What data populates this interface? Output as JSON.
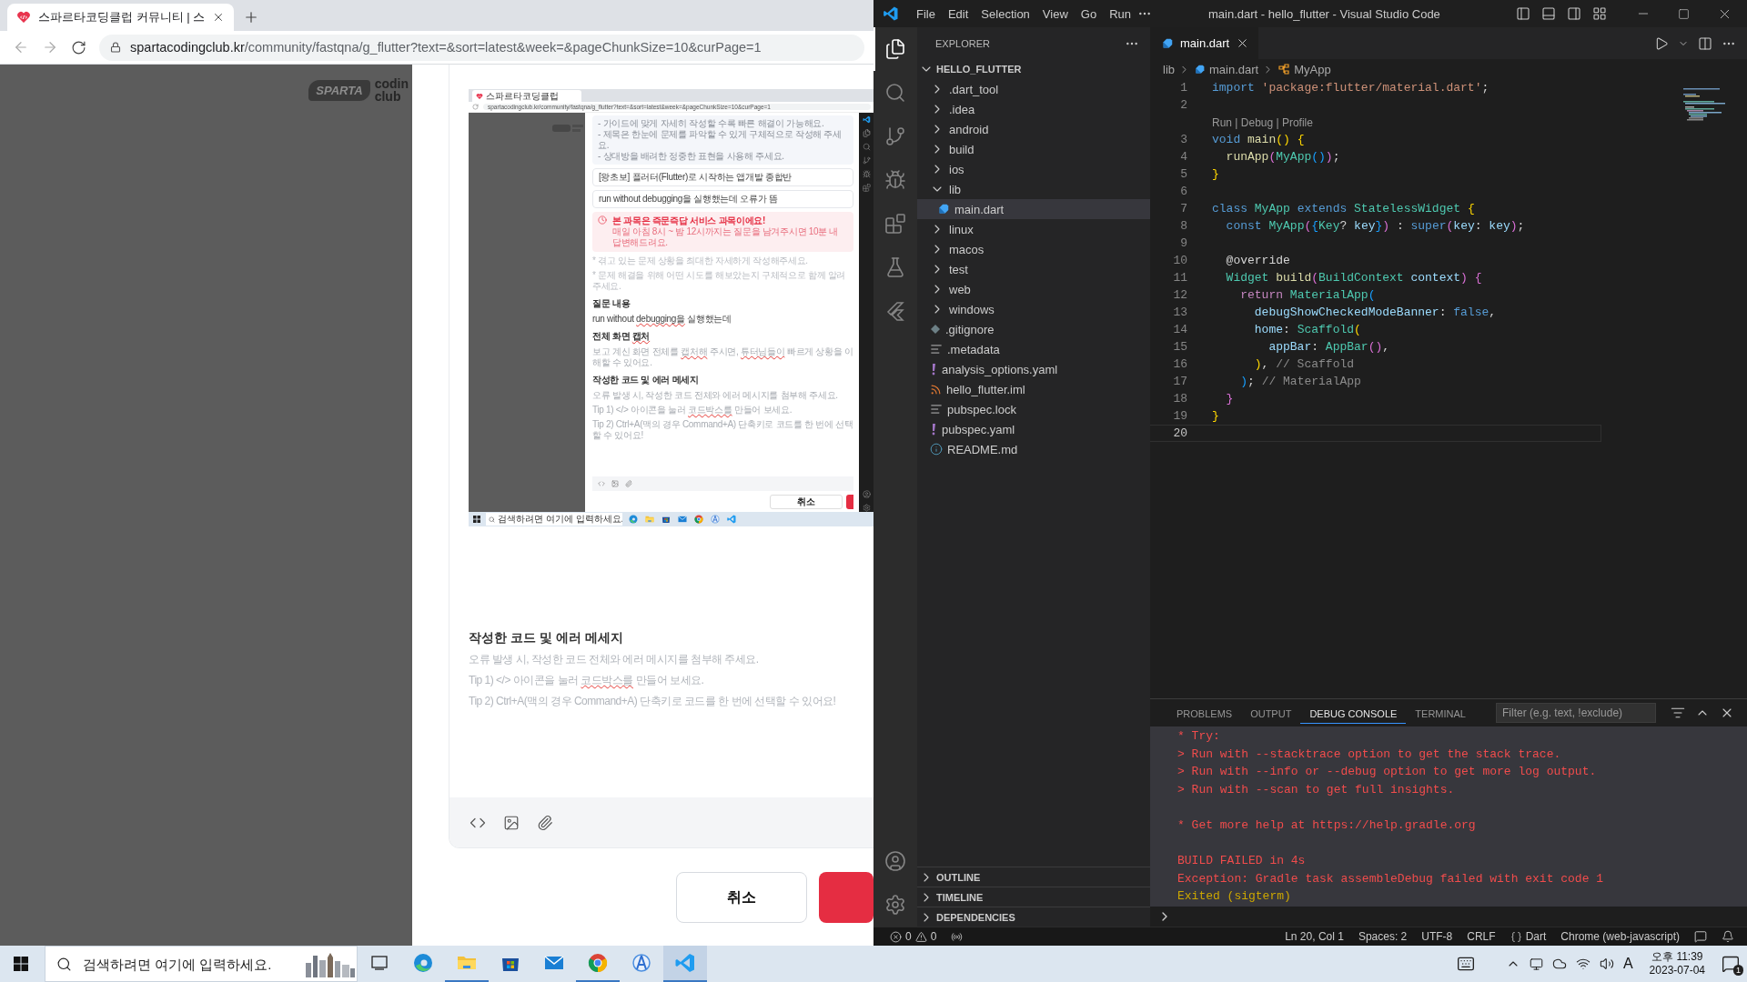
{
  "browser": {
    "tab": {
      "title": "스파르타코딩클럽 커뮤니티 | 스",
      "selected": true
    },
    "address": {
      "host": "spartacodingclub.kr",
      "path": "/community/fastqna/g_flutter?text=&sort=latest&week=&pageChunkSize=10&curPage=1"
    },
    "logo": {
      "mark": "SPARTA",
      "word_1": "codin",
      "word_2": "club"
    },
    "embedded_screenshot": {
      "tab_title": "스파르타코딩클럽",
      "url": "spartacodingclub.kr/community/fastqna/g_flutter?text=&sort=latest&week=&pageChunkSize=10&curPage=1",
      "guide": [
        "- 가이드에 맞게 자세히 작성할 수록 빠른 해결이 가능해요.",
        "- 제목은 한눈에 문제를 파악할 수 있게 구체적으로 작성해 주세요.",
        "- 상대방을 배려한 정중한 표현을 사용해 주세요."
      ],
      "course": "[왕초보] 플러터(Flutter)로 시작하는 앱개발 종합반",
      "title": "run without debugging을 실행했는데 오류가 뜸",
      "notice": {
        "title": "본 과목은 즉문즉답 서비스 과목이에요!",
        "text": "매일 아침 8시 ~ 밤 12시까지는 질문을 남겨주시면 10분 내 답변해드려요."
      },
      "hints": [
        "* 겪고 있는 문제 상황을 최대한 자세하게 작성해주세요.",
        "* 문제 해결을 위해 어떤 시도를 해보았는지 구체적으로 함께 알려주세요."
      ],
      "blocks": [
        {
          "heading": [
            {
              "text": "질문 내용",
              "misspelled": false
            }
          ],
          "kind": "value",
          "lines": [
            [
              {
                "text": "run without ",
                "misspelled": false
              },
              {
                "text": "debugging을",
                "misspelled": true
              },
              {
                "text": " 실행했는데",
                "misspelled": false
              }
            ]
          ]
        },
        {
          "heading": [
            {
              "text": "전체 화면 ",
              "misspelled": false
            },
            {
              "text": "캡처",
              "misspelled": true
            }
          ],
          "kind": "hint",
          "lines": [
            [
              {
                "text": "보고 계신 화면 전체를 ",
                "misspelled": false
              },
              {
                "text": "캡처해",
                "misspelled": true
              },
              {
                "text": " 주시면, ",
                "misspelled": false
              },
              {
                "text": "튜터님들이",
                "misspelled": true
              },
              {
                "text": " 빠르게 상황을 이해할 수 있어요.",
                "misspelled": false
              }
            ]
          ]
        },
        {
          "heading": [
            {
              "text": "작성한 코드 및 에러 메세지",
              "misspelled": false
            }
          ],
          "kind": "hint",
          "lines": [
            [
              {
                "text": "오류 발생 시, 작성한 코드 전체와 에러 메시지를 첨부해 주세요.",
                "misspelled": false
              }
            ],
            [
              {
                "text": "Tip 1) </> 아이콘을 눌러 ",
                "misspelled": false
              },
              {
                "text": "코드박스를",
                "misspelled": true
              },
              {
                "text": " 만들어 보세요.",
                "misspelled": false
              }
            ],
            [
              {
                "text": "Tip 2) Ctrl+A(맥의 경우 Command+A) 단축키로 코드를 한 번에 선택할 수 있어요!",
                "misspelled": false
              }
            ]
          ]
        }
      ],
      "cancel": "취소",
      "taskbar_search": "검색하려면 여기에 입력하세요."
    },
    "section": {
      "heading": "작성한 코드 및 에러 메세지",
      "lines": [
        [
          {
            "text": "오류 발생 시, 작성한 코드 전체와 에러 메시지를 첨부해 주세요.",
            "misspelled": false
          }
        ],
        [
          {
            "text": "Tip 1) </> 아이콘을 눌러 ",
            "misspelled": false
          },
          {
            "text": "코드박스를",
            "misspelled": true
          },
          {
            "text": " 만들어 보세요.",
            "misspelled": false
          }
        ],
        [
          {
            "text": "Tip 2) Ctrl+A(맥의 경우 Command+A) 단축키로 코드를 한 번에 선택할 수 있어요!",
            "misspelled": false
          }
        ]
      ]
    },
    "cancel": "취소"
  },
  "vscode": {
    "menu": [
      "File",
      "Edit",
      "Selection",
      "View",
      "Go",
      "Run"
    ],
    "title": "main.dart - hello_flutter - Visual Studio Code",
    "activity": [
      {
        "kind": "explorer",
        "selected": true
      },
      {
        "kind": "search",
        "selected": false
      },
      {
        "kind": "source-control",
        "selected": false
      },
      {
        "kind": "run-debug",
        "selected": false
      },
      {
        "kind": "extensions",
        "selected": false
      },
      {
        "kind": "testing",
        "selected": false
      },
      {
        "kind": "flutter",
        "selected": false
      }
    ],
    "explorer": {
      "title": "EXPLORER",
      "root": {
        "label": "HELLO_FLUTTER",
        "expanded": true
      },
      "items": [
        {
          "kind": "folder",
          "name": ".dart_tool",
          "expanded": false,
          "selected": false
        },
        {
          "kind": "folder",
          "name": ".idea",
          "expanded": false,
          "selected": false
        },
        {
          "kind": "folder",
          "name": "android",
          "expanded": false,
          "selected": false
        },
        {
          "kind": "folder",
          "name": "build",
          "expanded": false,
          "selected": false
        },
        {
          "kind": "folder",
          "name": "ios",
          "expanded": false,
          "selected": false
        },
        {
          "kind": "folder",
          "name": "lib",
          "expanded": true,
          "selected": false,
          "children": [
            {
              "kind": "dart-file",
              "name": "main.dart",
              "selected": true
            }
          ]
        },
        {
          "kind": "folder",
          "name": "linux",
          "expanded": false,
          "selected": false
        },
        {
          "kind": "folder",
          "name": "macos",
          "expanded": false,
          "selected": false
        },
        {
          "kind": "folder",
          "name": "test",
          "expanded": false,
          "selected": false
        },
        {
          "kind": "folder",
          "name": "web",
          "expanded": false,
          "selected": false
        },
        {
          "kind": "folder",
          "name": "windows",
          "expanded": false,
          "selected": false
        },
        {
          "kind": "ignore-file",
          "name": ".gitignore",
          "selected": false
        },
        {
          "kind": "text-file",
          "name": ".metadata",
          "selected": false
        },
        {
          "kind": "yaml-file",
          "name": "analysis_options.yaml",
          "selected": false
        },
        {
          "kind": "iml-file",
          "name": "hello_flutter.iml",
          "selected": false
        },
        {
          "kind": "text-file",
          "name": "pubspec.lock",
          "selected": false
        },
        {
          "kind": "yaml-file",
          "name": "pubspec.yaml",
          "selected": false
        },
        {
          "kind": "readme-file",
          "name": "README.md",
          "selected": false
        }
      ]
    },
    "sections": [
      {
        "label": "OUTLINE",
        "expanded": false
      },
      {
        "label": "TIMELINE",
        "expanded": false
      },
      {
        "label": "DEPENDENCIES",
        "expanded": false
      }
    ],
    "editor": {
      "tab": {
        "label": "main.dart",
        "selected": true
      },
      "breadcrumb": [
        "lib",
        "main.dart",
        "MyApp"
      ],
      "lines": [
        {
          "kind": "code",
          "number": "1",
          "current": false,
          "tokens": [
            {
              "kind": "keyword",
              "text": "import "
            },
            {
              "kind": "string",
              "text": "'package:flutter/material.dart'"
            },
            {
              "kind": "plain",
              "text": ";"
            }
          ]
        },
        {
          "kind": "code",
          "number": "2",
          "current": false
        },
        {
          "kind": "codelens",
          "text": "Run | Debug | Profile"
        },
        {
          "kind": "code",
          "number": "3",
          "current": false,
          "tokens": [
            {
              "kind": "keyword",
              "text": "void "
            },
            {
              "kind": "function",
              "text": "main"
            },
            {
              "kind": "bracket1",
              "text": "() {"
            }
          ]
        },
        {
          "kind": "code",
          "number": "4",
          "current": false,
          "tokens": [
            {
              "kind": "function",
              "text": "  runApp"
            },
            {
              "kind": "bracket2",
              "text": "("
            },
            {
              "kind": "type",
              "text": "MyApp"
            },
            {
              "kind": "bracket3",
              "text": "()"
            },
            {
              "kind": "bracket2",
              "text": ")"
            },
            {
              "kind": "plain",
              "text": ";"
            }
          ]
        },
        {
          "kind": "code",
          "number": "5",
          "current": false,
          "tokens": [
            {
              "kind": "bracket1",
              "text": "}"
            }
          ]
        },
        {
          "kind": "code",
          "number": "6",
          "current": false
        },
        {
          "kind": "code",
          "number": "7",
          "current": false,
          "tokens": [
            {
              "kind": "keyword",
              "text": "class "
            },
            {
              "kind": "type",
              "text": "MyApp "
            },
            {
              "kind": "keyword",
              "text": "extends "
            },
            {
              "kind": "type",
              "text": "StatelessWidget "
            },
            {
              "kind": "bracket1",
              "text": "{"
            }
          ]
        },
        {
          "kind": "code",
          "number": "8",
          "current": false,
          "tokens": [
            {
              "kind": "keyword",
              "text": "  const "
            },
            {
              "kind": "type",
              "text": "MyApp"
            },
            {
              "kind": "bracket2",
              "text": "("
            },
            {
              "kind": "bracket3",
              "text": "{"
            },
            {
              "kind": "type",
              "text": "Key"
            },
            {
              "kind": "plain",
              "text": "? "
            },
            {
              "kind": "variable",
              "text": "key"
            },
            {
              "kind": "bracket3",
              "text": "}"
            },
            {
              "kind": "bracket2",
              "text": ")"
            },
            {
              "kind": "plain",
              "text": " : "
            },
            {
              "kind": "keyword",
              "text": "super"
            },
            {
              "kind": "bracket2",
              "text": "("
            },
            {
              "kind": "variable",
              "text": "key"
            },
            {
              "kind": "plain",
              "text": ": "
            },
            {
              "kind": "variable",
              "text": "key"
            },
            {
              "kind": "bracket2",
              "text": ")"
            },
            {
              "kind": "plain",
              "text": ";"
            }
          ]
        },
        {
          "kind": "code",
          "number": "9",
          "current": false
        },
        {
          "kind": "code",
          "number": "10",
          "current": false,
          "tokens": [
            {
              "kind": "annotation",
              "text": "  @override"
            }
          ]
        },
        {
          "kind": "code",
          "number": "11",
          "current": false,
          "tokens": [
            {
              "kind": "type",
              "text": "  Widget "
            },
            {
              "kind": "function",
              "text": "build"
            },
            {
              "kind": "bracket2",
              "text": "("
            },
            {
              "kind": "type",
              "text": "BuildContext "
            },
            {
              "kind": "variable",
              "text": "context"
            },
            {
              "kind": "bracket2",
              "text": ") {"
            }
          ]
        },
        {
          "kind": "code",
          "number": "12",
          "current": false,
          "tokens": [
            {
              "kind": "control",
              "text": "    return "
            },
            {
              "kind": "type",
              "text": "MaterialApp"
            },
            {
              "kind": "bracket3",
              "text": "("
            }
          ]
        },
        {
          "kind": "code",
          "number": "13",
          "current": false,
          "tokens": [
            {
              "kind": "variable",
              "text": "      debugShowCheckedModeBanner"
            },
            {
              "kind": "plain",
              "text": ": "
            },
            {
              "kind": "keyword",
              "text": "false"
            },
            {
              "kind": "plain",
              "text": ","
            }
          ]
        },
        {
          "kind": "code",
          "number": "14",
          "current": false,
          "tokens": [
            {
              "kind": "variable",
              "text": "      home"
            },
            {
              "kind": "plain",
              "text": ": "
            },
            {
              "kind": "type",
              "text": "Scaffold"
            },
            {
              "kind": "bracket1",
              "text": "("
            }
          ]
        },
        {
          "kind": "code",
          "number": "15",
          "current": false,
          "tokens": [
            {
              "kind": "variable",
              "text": "        appBar"
            },
            {
              "kind": "plain",
              "text": ": "
            },
            {
              "kind": "type",
              "text": "AppBar"
            },
            {
              "kind": "bracket2",
              "text": "()"
            },
            {
              "kind": "plain",
              "text": ","
            }
          ]
        },
        {
          "kind": "code",
          "number": "16",
          "current": false,
          "tokens": [
            {
              "kind": "bracket1",
              "text": "      )"
            },
            {
              "kind": "plain",
              "text": ", "
            },
            {
              "kind": "label",
              "text": "// Scaffold"
            }
          ]
        },
        {
          "kind": "code",
          "number": "17",
          "current": false,
          "tokens": [
            {
              "kind": "bracket3",
              "text": "    )"
            },
            {
              "kind": "plain",
              "text": "; "
            },
            {
              "kind": "label",
              "text": "// MaterialApp"
            }
          ]
        },
        {
          "kind": "code",
          "number": "18",
          "current": false,
          "tokens": [
            {
              "kind": "bracket2",
              "text": "  }"
            }
          ]
        },
        {
          "kind": "code",
          "number": "19",
          "current": false,
          "tokens": [
            {
              "kind": "bracket1",
              "text": "}"
            }
          ]
        },
        {
          "kind": "code",
          "number": "20",
          "current": true
        }
      ]
    },
    "panel": {
      "tabs": [
        {
          "label": "PROBLEMS",
          "selected": false
        },
        {
          "label": "OUTPUT",
          "selected": false
        },
        {
          "label": "DEBUG CONSOLE",
          "selected": true
        },
        {
          "label": "TERMINAL",
          "selected": false
        }
      ],
      "filter_placeholder": "Filter (e.g. text, !exclude)",
      "lines": [
        {
          "kind": "error",
          "text": "* Try:"
        },
        {
          "kind": "error",
          "text": "> Run with --stacktrace option to get the stack trace."
        },
        {
          "kind": "error",
          "text": "> Run with --info or --debug option to get more log output."
        },
        {
          "kind": "error",
          "text": "> Run with --scan to get full insights."
        },
        {
          "kind": "gap"
        },
        {
          "kind": "error",
          "text": "* Get more help at https://help.gradle.org"
        },
        {
          "kind": "gap"
        },
        {
          "kind": "error",
          "text": "BUILD FAILED in 4s"
        },
        {
          "kind": "error",
          "text": "Exception: Gradle task assembleDebug failed with exit code 1"
        },
        {
          "kind": "warning",
          "text": "Exited (sigterm)"
        }
      ]
    },
    "status": {
      "errors": "0",
      "warnings": "0",
      "items": [
        "Ln 20, Col 1",
        "Spaces: 2",
        "UTF-8",
        "CRLF"
      ],
      "language": "Dart",
      "target": "Chrome (web-javascript)"
    }
  },
  "taskbar": {
    "search_placeholder": "검색하려면 여기에 입력하세요.",
    "apps": [
      {
        "kind": "task-view",
        "running": false,
        "active": false
      },
      {
        "kind": "edge",
        "running": false,
        "active": false
      },
      {
        "kind": "file-explorer",
        "running": true,
        "active": false
      },
      {
        "kind": "store",
        "running": false,
        "active": false
      },
      {
        "kind": "mail",
        "running": false,
        "active": false
      },
      {
        "kind": "chrome",
        "running": true,
        "active": false
      },
      {
        "kind": "compass",
        "running": false,
        "active": false
      },
      {
        "kind": "vscode",
        "running": true,
        "active": true
      }
    ],
    "ime": "A",
    "time": "오후 11:39",
    "date": "2023-07-04",
    "notifications": "1"
  }
}
